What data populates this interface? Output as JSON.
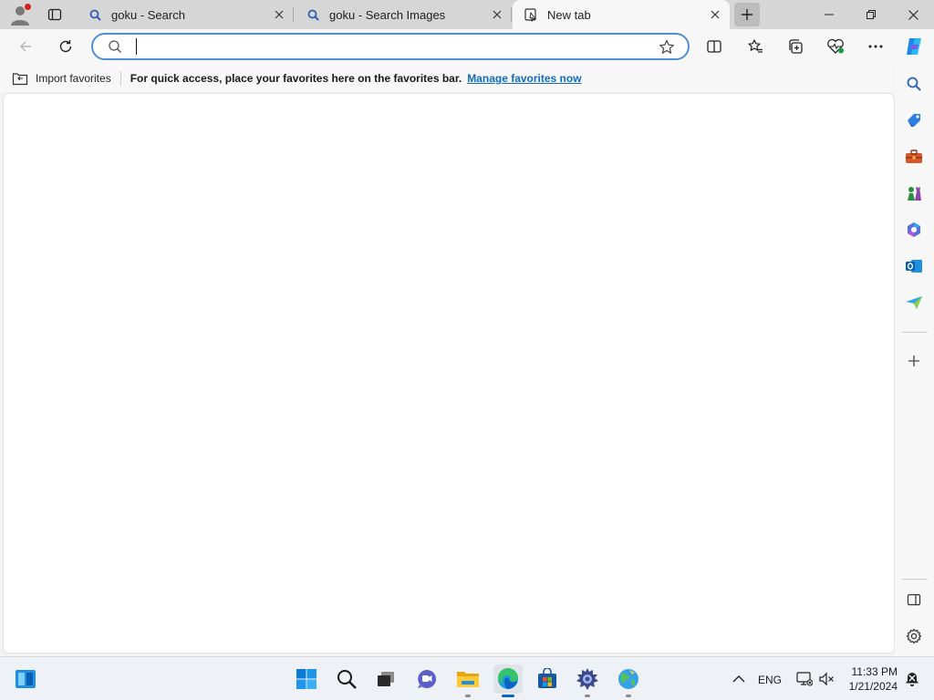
{
  "tabs": [
    {
      "title": "goku - Search",
      "icon": "search-icon"
    },
    {
      "title": "goku - Search Images",
      "icon": "search-icon"
    },
    {
      "title": "New tab",
      "icon": "newtab-page-icon"
    }
  ],
  "address_bar": {
    "value": "",
    "placeholder": ""
  },
  "favorites_bar": {
    "import_label": "Import favorites",
    "hint": "For quick access, place your favorites here on the favorites bar.",
    "manage_link": "Manage favorites now"
  },
  "taskbar": {
    "language": "ENG",
    "time": "11:33 PM",
    "date": "1/21/2024"
  },
  "colors": {
    "accent": "#0f6cbd",
    "address_border": "#4f8fd6",
    "notification_dot": "#d52020"
  }
}
